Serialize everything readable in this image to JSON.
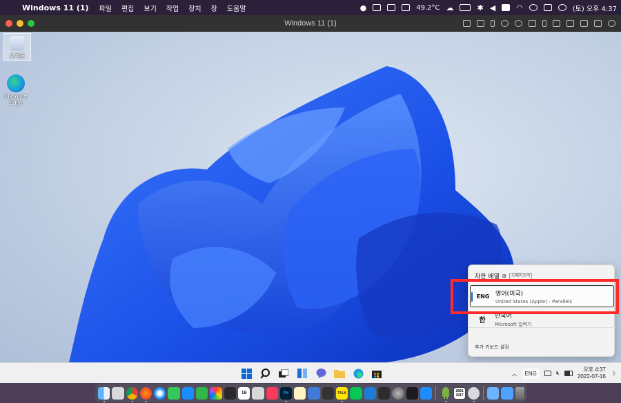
{
  "mac_menubar": {
    "app_name": "Windows 11 (1)",
    "menus": [
      "파일",
      "편집",
      "보기",
      "작업",
      "장치",
      "창",
      "도움말"
    ],
    "temperature": "49.2°C",
    "datetime": "(토) 오후 4:37"
  },
  "vm_window": {
    "title": "Windows 11 (1)"
  },
  "desktop": {
    "icons": [
      {
        "label": "휴지통"
      },
      {
        "label": "Microsoft Edge"
      }
    ]
  },
  "keyboard_flyout": {
    "title": "자판 배열",
    "shortcut_hint": "스페이스바",
    "languages": [
      {
        "code": "ENG",
        "name": "영어(미국)",
        "sub": "United States (Apple) - Parallels",
        "active": true
      },
      {
        "code": "한",
        "name": "한국어",
        "sub": "Microsoft 입력기",
        "active": false
      }
    ],
    "footer": "추가 키보드 설정"
  },
  "taskbar": {
    "input_indicator": "ENG",
    "time": "오후 4:37",
    "date": "2022-07-16"
  },
  "dock": {
    "calendar_day": "16",
    "stats_top": "2691",
    "stats_bottom": "1917"
  }
}
